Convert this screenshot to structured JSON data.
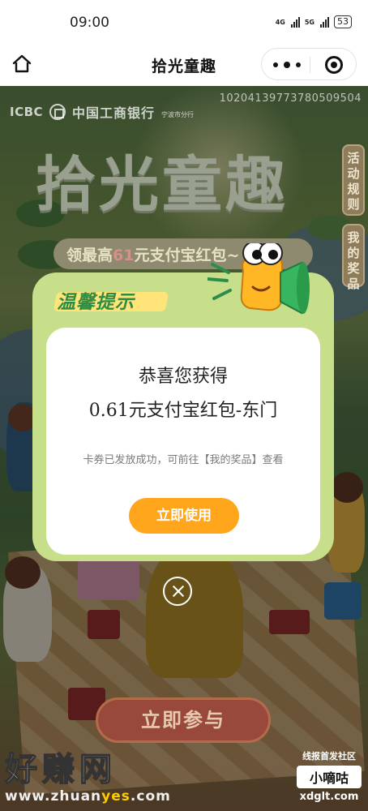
{
  "status_bar": {
    "time": "09:00",
    "signal1_label": "4G",
    "signal2_label": "5G",
    "battery": "53"
  },
  "nav": {
    "title": "拾光童趣"
  },
  "background": {
    "bank_name_en": "ICBC",
    "bank_name_cn": "中国工商银行",
    "branch": "宁波市分行",
    "serial": "10204139773780509504",
    "hero_title": "拾光童趣",
    "banner_prefix": "领最高",
    "banner_amount": "61",
    "banner_suffix": "元支付宝红包~",
    "side_rules": "活动规则",
    "side_prizes": "我的奖品",
    "join_button": "立即参与"
  },
  "modal": {
    "title": "温馨提示",
    "congrats": "恭喜您获得",
    "prize": "0.61元支付宝红包-东门",
    "notice": "卡券已发放成功，可前往【我的奖品】查看",
    "use_button": "立即使用"
  },
  "watermark": {
    "left_big": "好赚网",
    "left_url_a": "www.zhuan",
    "left_url_b": "yes",
    "left_url_c": ".com",
    "right_top": "线报首发社区",
    "right_mid": "小嘀咕",
    "right_url": "xdglt.com"
  },
  "colors": {
    "modal_frame": "#c7df8a",
    "modal_title": "#2e8c44",
    "use_button": "#ffa61c"
  }
}
